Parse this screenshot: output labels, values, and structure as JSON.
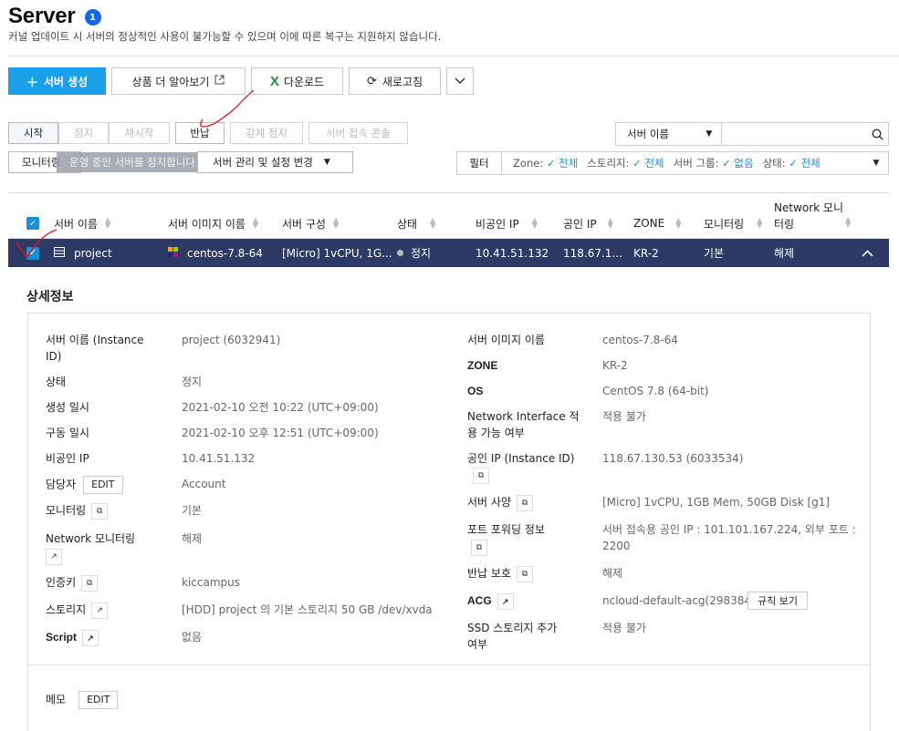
{
  "header": {
    "title": "Server",
    "badge": "1",
    "subtitle": "커널 업데이트 시 서버의 정상적인 사용이 불가능할 수 있으며 이에 따른 복구는 지원하지 않습니다."
  },
  "toolbar": {
    "create_label": "서버 생성",
    "learn_more_label": "상품 더 알아보기",
    "download_label": "다운로드",
    "refresh_label": "새로고침"
  },
  "actions": {
    "start": "시작",
    "stop": "정지",
    "restart": "재시작",
    "return": "반납",
    "force_stop": "강제 정지",
    "console": "서버 접속 콘솔",
    "monitoring": "모니터링",
    "ops_text": "운영 중인 서버를 정지합니다",
    "manage": "서버 관리 및 설정 변경"
  },
  "search": {
    "select_value": "서버 이름",
    "placeholder": ""
  },
  "filter": {
    "label": "필터",
    "items": [
      {
        "key": "Zone:",
        "value": "전체"
      },
      {
        "key": "스토리지:",
        "value": "전체"
      },
      {
        "key": "서버 그룹:",
        "value": "없음"
      },
      {
        "key": "상태:",
        "value": "전체"
      }
    ]
  },
  "table": {
    "columns": [
      "서버 이름",
      "서버 이미지 이름",
      "서버 구성",
      "상태",
      "비공인 IP",
      "공인 IP",
      "ZONE",
      "모니터링",
      "Network 모니\n터링"
    ],
    "row": {
      "name": "project",
      "image": "centos-7.8-64",
      "spec": "[Micro] 1vCPU, 1G...",
      "status": "정지",
      "private_ip": "10.41.51.132",
      "public_ip": "118.67.1...",
      "zone": "KR-2",
      "monitoring": "기본",
      "net_monitoring": "해제"
    }
  },
  "detail": {
    "title": "상세정보",
    "left": {
      "name_label": "서버 이름 (Instance ID)",
      "name_value": "project (6032941)",
      "status_label": "상태",
      "status_value": "정지",
      "created_label": "생성 일시",
      "created_value": "2021-02-10 오전 10:22 (UTC+09:00)",
      "run_label": "구동 일시",
      "run_value": "2021-02-10 오후 12:51 (UTC+09:00)",
      "private_ip_label": "비공인 IP",
      "private_ip_value": "10.41.51.132",
      "owner_label": "담당자",
      "owner_edit": "EDIT",
      "owner_value": "Account",
      "monitoring_label": "모니터링",
      "monitoring_value": "기본",
      "net_mon_label": "Network 모니터링",
      "net_mon_value": "해제",
      "key_label": "인증키",
      "key_value": "kiccampus",
      "storage_label": "스토리지",
      "storage_value": "[HDD] project 의 기본 스토리지  50 GB /dev/xvda",
      "script_label": "Script",
      "script_value": "없음"
    },
    "right": {
      "image_label": "서버 이미지 이름",
      "image_value": "centos-7.8-64",
      "zone_label": "ZONE",
      "zone_value": "KR-2",
      "os_label": "OS",
      "os_value": "CentOS 7.8 (64-bit)",
      "ni_label": "Network Interface 적용 가능 여부",
      "ni_value": "적용 불가",
      "public_ip_label": "공인 IP (Instance ID)",
      "public_ip_value": "118.67.130.53 (6033534)",
      "spec_label": "서버 사양",
      "spec_value": "[Micro] 1vCPU, 1GB Mem, 50GB Disk [g1]",
      "pf_label": "포트 포워딩 정보",
      "pf_value_1": "서버 접속용 공인 IP : 101.101.167.224, 외부 포트 :",
      "pf_value_2": "2200",
      "protect_label": "반납 보호",
      "protect_value": "해제",
      "acg_label": "ACG",
      "acg_value": "ncloud-default-acg(298384)",
      "acg_rule_btn": "규칙 보기",
      "ssd_label": "SSD 스토리지 추가 여부",
      "ssd_value": "적용 불가"
    },
    "memo_label": "메모",
    "memo_edit": "EDIT"
  },
  "colors": {
    "primary": "#1aa0e6",
    "selected_row": "#2e3a66",
    "link": "#1a8fd8",
    "annotation": "#e0151d"
  }
}
